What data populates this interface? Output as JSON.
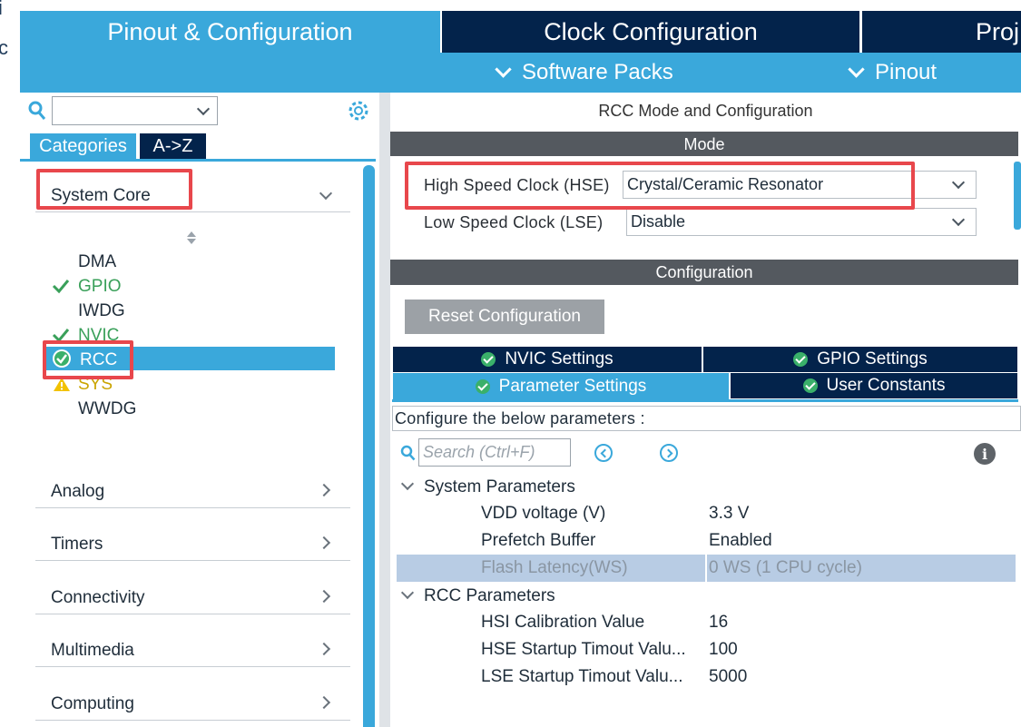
{
  "top_tabs": {
    "pinout_config": "Pinout & Configuration",
    "clock_config": "Clock Configuration",
    "project": "Proj"
  },
  "subbar": {
    "software_packs": "Software Packs",
    "pinout": "Pinout"
  },
  "edge": {
    "top_glyph": "i",
    "mid_glyph": "c"
  },
  "left": {
    "tabs": [
      "Categories",
      "A->Z"
    ],
    "groups": {
      "system_core": "System Core",
      "analog": "Analog",
      "timers": "Timers",
      "connectivity": "Connectivity",
      "multimedia": "Multimedia",
      "computing": "Computing"
    },
    "items": [
      {
        "label": "DMA",
        "status": "none"
      },
      {
        "label": "GPIO",
        "status": "ok"
      },
      {
        "label": "IWDG",
        "status": "none"
      },
      {
        "label": "NVIC",
        "status": "ok"
      },
      {
        "label": "RCC",
        "status": "selected"
      },
      {
        "label": "SYS",
        "status": "warning"
      },
      {
        "label": "WWDG",
        "status": "none"
      }
    ]
  },
  "right": {
    "heading": "RCC Mode and Configuration",
    "mode_bar": "Mode",
    "hse_label": "High Speed Clock (HSE)",
    "hse_value": "Crystal/Ceramic Resonator",
    "lse_label": "Low Speed Clock (LSE)",
    "lse_value": "Disable",
    "config_bar": "Configuration",
    "reset_button": "Reset Configuration",
    "settings_tabs": {
      "nvic": "NVIC Settings",
      "gpio": "GPIO Settings",
      "parameter": "Parameter Settings",
      "user_constants": "User Constants"
    },
    "configure_text": "Configure the below parameters :",
    "search_placeholder": "Search (Ctrl+F)",
    "info_glyph": "i",
    "sections": {
      "system": "System Parameters",
      "rcc": "RCC Parameters"
    },
    "system_params": [
      {
        "name": "VDD voltage (V)",
        "value": "3.3 V"
      },
      {
        "name": "Prefetch Buffer",
        "value": "Enabled"
      },
      {
        "name": "Flash Latency(WS)",
        "value": "0 WS (1 CPU cycle)"
      }
    ],
    "rcc_params": [
      {
        "name": "HSI Calibration Value",
        "value": "16"
      },
      {
        "name": "HSE Startup Timout Valu...",
        "value": "100"
      },
      {
        "name": "LSE Startup Timout Valu...",
        "value": "5000"
      }
    ]
  },
  "colors": {
    "accent_blue": "#3aa8db",
    "dark_navy": "#03234b",
    "highlight_red": "#e8474c",
    "ok_green": "#3aa05a",
    "warning_yellow": "#f2c200"
  }
}
